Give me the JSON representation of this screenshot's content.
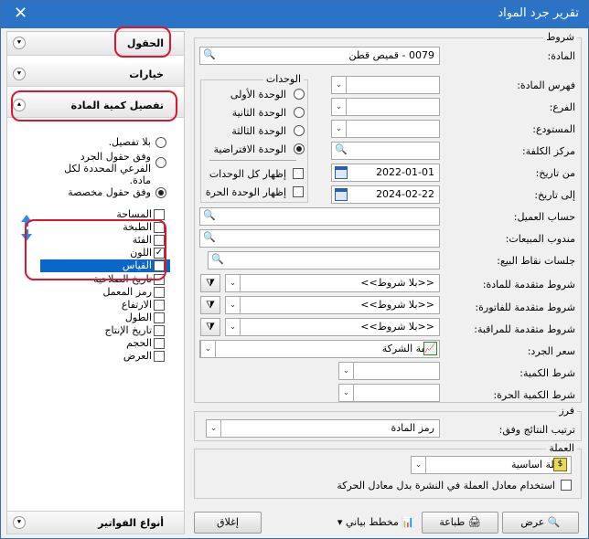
{
  "window": {
    "title": "تقرير جرد المواد",
    "close_glyph": "✕"
  },
  "left": {
    "fields_header": "الحقول",
    "options_header": "خيارات",
    "detail_header": "تفصيل كمية المادة",
    "invoice_types_header": "أنواع الفواتير",
    "radios": [
      "بلا تفصيل.",
      "وفق حقول الجرد الفرعي المحددة لكل مادة.",
      "وفق حقول مخصصة"
    ],
    "selected_radio": 2,
    "fields": [
      {
        "label": "المساحة",
        "checked": false
      },
      {
        "label": "الطبخة",
        "checked": false
      },
      {
        "label": "الفئة",
        "checked": false
      },
      {
        "label": "اللون",
        "checked": true
      },
      {
        "label": "القياس",
        "checked": true
      },
      {
        "label": "تاريخ الصلاحية",
        "checked": false
      },
      {
        "label": "رمز المعمل",
        "checked": false
      },
      {
        "label": "الارتفاع",
        "checked": false
      },
      {
        "label": "الطول",
        "checked": false
      },
      {
        "label": "تاريخ الإنتاج",
        "checked": false
      },
      {
        "label": "الحجم",
        "checked": false
      },
      {
        "label": "العرض",
        "checked": false
      }
    ],
    "selected_field": 4,
    "accent_red": "#e0142a",
    "selection_blue": "#0a66c8"
  },
  "conditions": {
    "legend": "شروط",
    "material_label": "المادة:",
    "material_value": "0079 - قميص قطن",
    "material_index_label": "فهرس المادة:",
    "branch_label": "الفرع:",
    "warehouse_label": "المستودع:",
    "cost_center_label": "مركز الكلفة:",
    "from_date_label": "من تاريخ:",
    "from_date": "2022-01-01",
    "to_date_label": "إلى تاريخ:",
    "to_date": "2024-02-22",
    "customer_account_label": "حساب العميل:",
    "sales_rep_label": "مندوب المبيعات:",
    "pos_sessions_label": "جلسات نقاط البيع:",
    "adv_material_label": "شروط متقدمة للمادة:",
    "adv_invoice_label": "شروط متقدمة للفاتورة:",
    "adv_audit_label": "شروط متقدمة للمراقبة:",
    "no_conditions": "<<بلا شروط>>",
    "inventory_price_label": "سعر الجرد:",
    "inventory_price_value": "كلفة الشركة",
    "quantity_condition_label": "شرط الكمية:",
    "free_quantity_condition_label": "شرط الكمية الحرة:",
    "units": {
      "legend": "الوحدات",
      "options": [
        "الوحدة الأولى",
        "الوحدة الثانية",
        "الوحدة الثالثة",
        "الوحدة الافتراضية"
      ],
      "selected": 3,
      "show_all_units": "إظهار كل الوحدات",
      "show_free_unit": "إظهار الوحدة الحرة"
    }
  },
  "sort": {
    "legend": "فرز",
    "label": "ترتيب النتائج وفق:",
    "value": "رمز المادة"
  },
  "currency": {
    "legend": "العملة",
    "value": "عملة اساسية",
    "use_bulletin_rate": "استخدام معادل العملة في النشرة بدل معادل الحركة"
  },
  "buttons": {
    "display": "عرض",
    "print": "طباعة",
    "chart": "مخطط بياني",
    "close": "إغلاق"
  }
}
